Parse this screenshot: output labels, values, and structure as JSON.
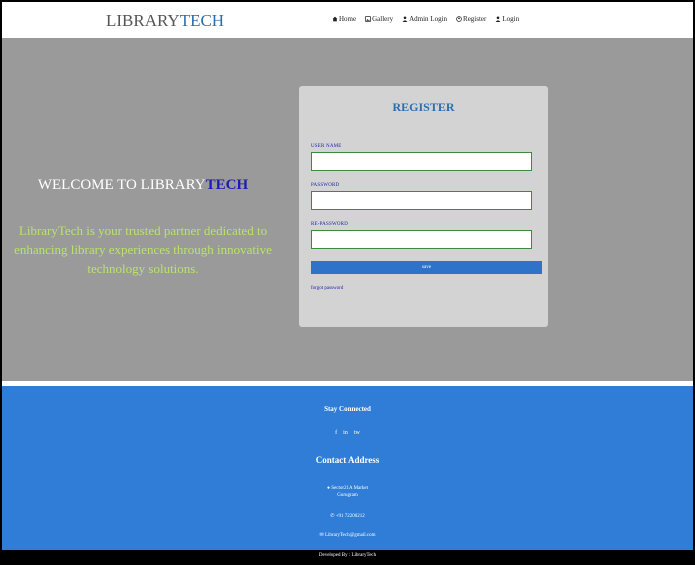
{
  "header": {
    "brand_part1": "LIBRARY",
    "brand_part2": "TECH",
    "nav": [
      {
        "label": "Home",
        "icon": "home-icon"
      },
      {
        "label": "Gallery",
        "icon": "image-icon"
      },
      {
        "label": "Admin Login",
        "icon": "user-icon"
      },
      {
        "label": "Register",
        "icon": "register-icon"
      },
      {
        "label": "Login",
        "icon": "user-icon"
      }
    ]
  },
  "hero": {
    "welcome_prefix": "WELCOME TO LIBRARY",
    "welcome_highlight": "TECH",
    "tagline": "LibraryTech is your trusted partner dedicated to enhancing library experiences through innovative technology solutions."
  },
  "register_form": {
    "title": "REGISTER",
    "username_label": "USER NAME",
    "username_value": "",
    "password_label": "PASSWORD",
    "password_value": "",
    "repassword_label": "RE-PASSWORD",
    "repassword_value": "",
    "save_label": "save",
    "forgot_label": "forgot password"
  },
  "footer": {
    "stay_connected": "Stay Connected",
    "socials": [
      "f",
      "in",
      "tw"
    ],
    "contact_heading": "Contact Address",
    "address_line1": "Sector21A Market",
    "address_line2": "Gurugram",
    "phone": "+91 72200212",
    "email": "LibraryTech@gmail.com",
    "developed_by": "Developed By : LibraryTech"
  },
  "colors": {
    "accent": "#2f7dd6",
    "hero_bg": "#9a9a9a",
    "card_bg": "#d3d3d3",
    "tagline": "#b9e36a"
  }
}
